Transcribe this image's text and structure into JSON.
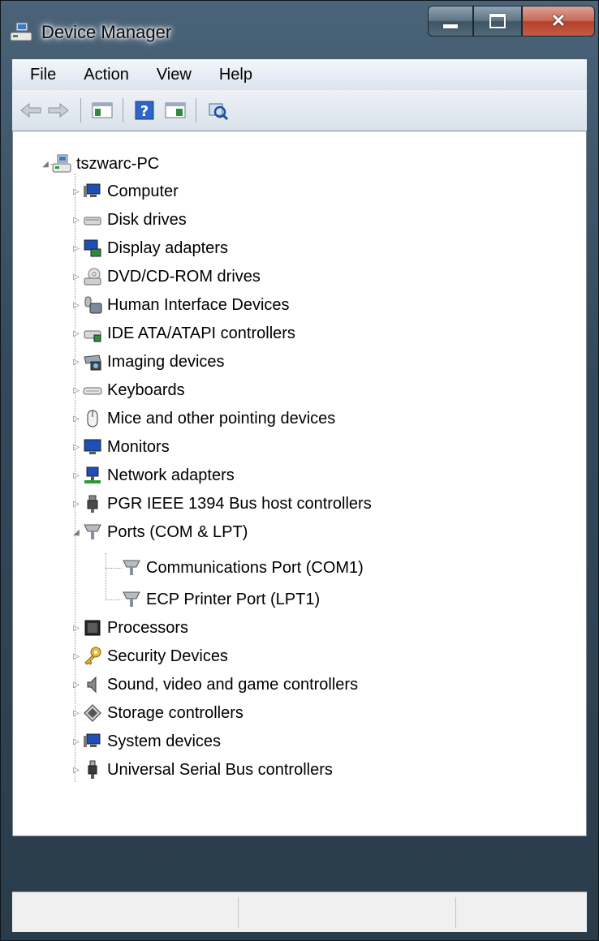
{
  "window": {
    "title": "Device Manager"
  },
  "menu": [
    "File",
    "Action",
    "View",
    "Help"
  ],
  "toolbar": {
    "buttons": [
      "back-icon",
      "forward-icon",
      "show-hide-console-tree-icon",
      "help-icon",
      "action-pane-icon",
      "scan-hardware-icon"
    ]
  },
  "tree": {
    "root": "tszwarc-PC",
    "categories": [
      "Computer",
      "Disk drives",
      "Display adapters",
      "DVD/CD-ROM drives",
      "Human Interface Devices",
      "IDE ATA/ATAPI controllers",
      "Imaging devices",
      "Keyboards",
      "Mice and other pointing devices",
      "Monitors",
      "Network adapters",
      "PGR IEEE 1394 Bus host controllers",
      "Ports (COM & LPT)",
      "Processors",
      "Security Devices",
      "Sound, video and game controllers",
      "Storage controllers",
      "System devices",
      "Universal Serial Bus controllers"
    ],
    "ports_children": [
      "Communications Port (COM1)",
      "ECP Printer Port (LPT1)"
    ]
  },
  "icons": {
    "computer": "computer-icon",
    "disk": "disk-drive-icon",
    "display": "display-adapter-icon",
    "dvd": "dvd-drive-icon",
    "hid": "hid-icon",
    "ide": "ide-controller-icon",
    "imaging": "camera-icon",
    "keyboard": "keyboard-icon",
    "mouse": "mouse-icon",
    "monitor": "monitor-icon",
    "network": "network-adapter-icon",
    "ieee1394": "firewire-icon",
    "port": "port-icon",
    "processor": "processor-icon",
    "security": "key-icon",
    "sound": "speaker-icon",
    "storage": "storage-controller-icon",
    "system": "system-device-icon",
    "usb": "usb-icon"
  }
}
